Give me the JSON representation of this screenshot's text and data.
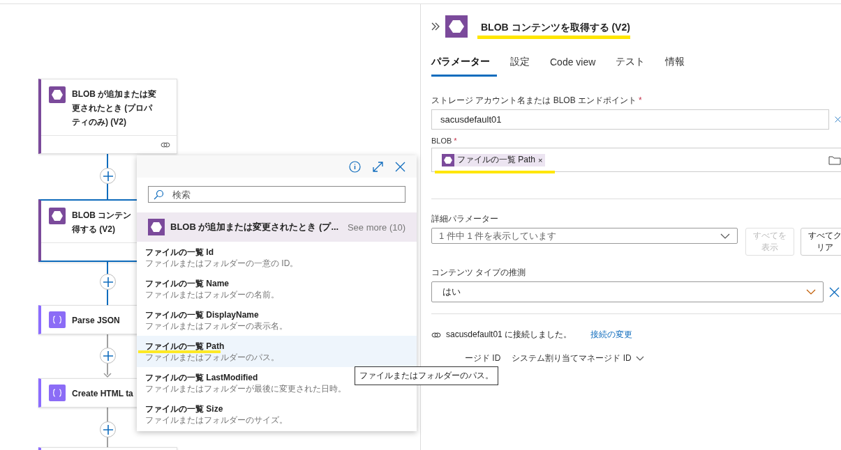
{
  "canvas": {
    "cards": [
      {
        "kind": "blob",
        "lines": [
          "BLOB が追加または変",
          "更されたとき (プロパ",
          "ティのみ) (V2)"
        ],
        "selected": false,
        "link": true
      },
      {
        "kind": "blob",
        "lines": [
          "BLOB コンテン",
          "得する (V2)"
        ],
        "selected": true
      },
      {
        "kind": "data",
        "lines": [
          "Parse JSON"
        ],
        "selected": false
      },
      {
        "kind": "data",
        "lines": [
          "Create HTML ta"
        ],
        "selected": false
      }
    ]
  },
  "popup": {
    "search": {
      "placeholder": "検索"
    },
    "group": {
      "title": "BLOB が追加または変更されたとき (プ...",
      "see_more": "See more (10)"
    },
    "items": [
      {
        "name": "ファイルの一覧 Id",
        "description": "ファイルまたはフォルダーの一意の ID。",
        "selected": false,
        "highlighted": false
      },
      {
        "name": "ファイルの一覧 Name",
        "description": "ファイルまたはフォルダーの名前。",
        "selected": false,
        "highlighted": false
      },
      {
        "name": "ファイルの一覧 DisplayName",
        "description": "ファイルまたはフォルダーの表示名。",
        "selected": false,
        "highlighted": false
      },
      {
        "name": "ファイルの一覧 Path",
        "description": "ファイルまたはフォルダーのパス。",
        "selected": true,
        "highlighted": true
      },
      {
        "name": "ファイルの一覧 LastModified",
        "description": "ファイルまたはフォルダーが最後に変更された日時。",
        "selected": false,
        "highlighted": false
      },
      {
        "name": "ファイルの一覧 Size",
        "description": "ファイルまたはフォルダーのサイズ。",
        "selected": false,
        "highlighted": false
      }
    ],
    "tooltip": "ファイルまたはフォルダーのパス。"
  },
  "panel": {
    "title": "BLOB コンテンツを取得する (V2)",
    "title_highlighted": true,
    "tabs": [
      {
        "label": "パラメーター",
        "selected": true
      },
      {
        "label": "設定",
        "selected": false
      },
      {
        "label": "Code view",
        "selected": false
      },
      {
        "label": "テスト",
        "selected": false
      },
      {
        "label": "情報",
        "selected": false
      }
    ],
    "storage": {
      "label": "ストレージ アカウント名または BLOB エンドポイント",
      "required": "*",
      "value": "sacusdefault01"
    },
    "blob": {
      "label": "BLOB",
      "required": "*",
      "token": "ファイルの一覧 Path",
      "token_close": "×",
      "highlighted": true
    },
    "advanced": {
      "label": "詳細パラメーター",
      "value": "1 件中 1 件を表示しています",
      "show_all": [
        "すべてを",
        "表示"
      ],
      "show_all_disabled": true,
      "clear_all": [
        "すべてク",
        "リア"
      ]
    },
    "content_type": {
      "label": "コンテンツ タイプの推測",
      "value": "はい"
    },
    "connection": {
      "text": "sacusdefault01 に接続しました。",
      "link": "接続の変更"
    },
    "identity": {
      "label": "ージド ID",
      "value": "システム割り当てマネージド ID"
    }
  }
}
